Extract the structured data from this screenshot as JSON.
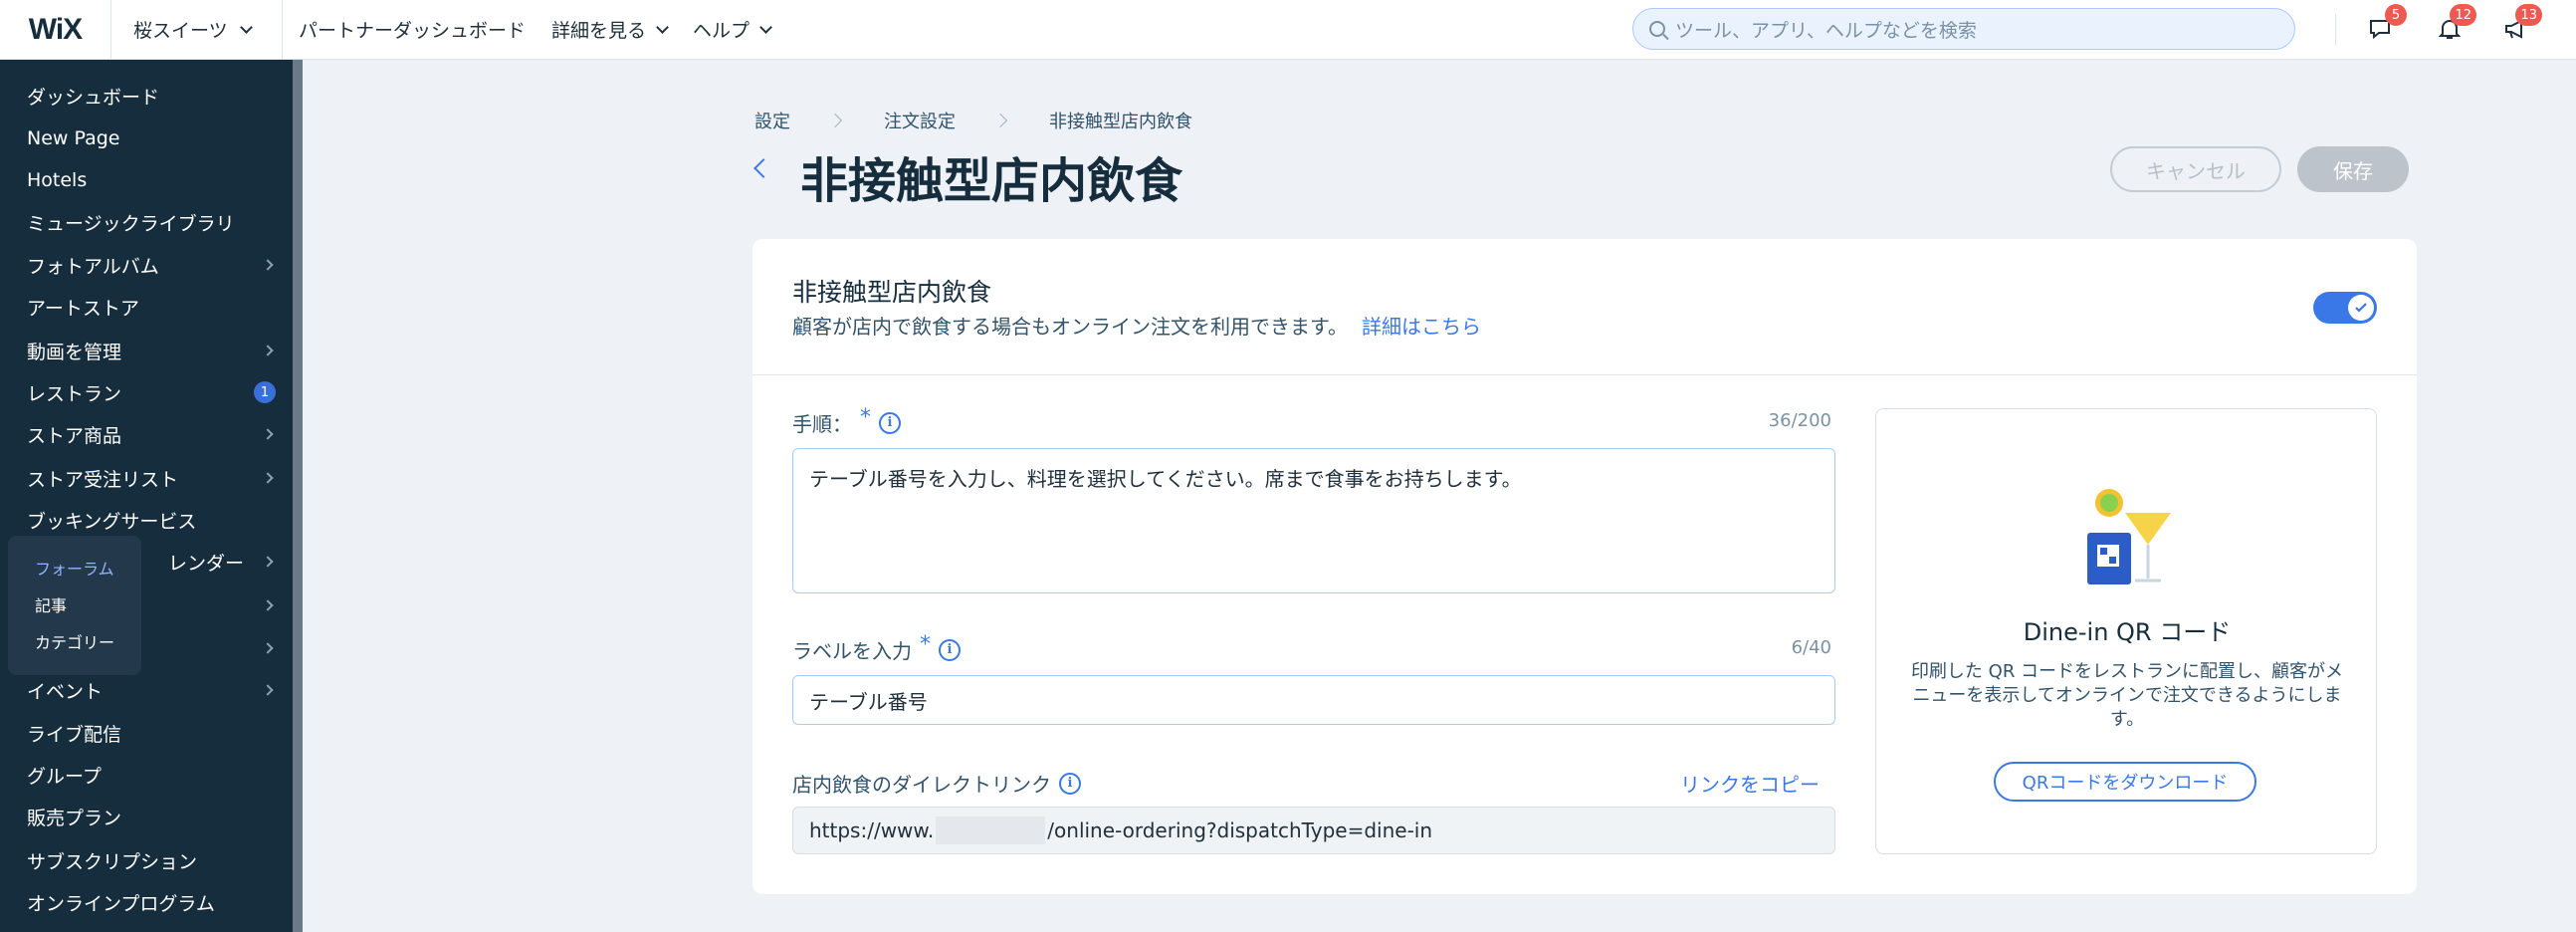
{
  "topbar": {
    "logo": "WiX",
    "site_name": "桜スイーツ",
    "nav": [
      "パートナーダッシュボード",
      "詳細を見る",
      "ヘルプ"
    ],
    "search_placeholder": "ツール、アプリ、ヘルプなどを検索",
    "badges": {
      "chat": "5",
      "notifications": "12",
      "announcements": "13"
    }
  },
  "sidebar": {
    "items": [
      {
        "label": "ダッシュボード",
        "chevron": false
      },
      {
        "label": "New Page",
        "chevron": false
      },
      {
        "label": "Hotels",
        "chevron": false
      },
      {
        "label": "ミュージックライブラリ",
        "chevron": false
      },
      {
        "label": "フォトアルバム",
        "chevron": true
      },
      {
        "label": "アートストア",
        "chevron": false
      },
      {
        "label": "動画を管理",
        "chevron": true
      },
      {
        "label": "レストラン",
        "badge": "1"
      },
      {
        "label": "ストア商品",
        "chevron": true
      },
      {
        "label": "ストア受注リスト",
        "chevron": true
      },
      {
        "label": "ブッキングサービス",
        "chevron": false
      },
      {
        "label": "レンダー",
        "chevron": true
      },
      {
        "label": "",
        "chevron": true
      },
      {
        "label": "",
        "chevron": true
      },
      {
        "label": "イベント",
        "chevron": true
      },
      {
        "label": "ライブ配信",
        "chevron": false
      },
      {
        "label": "グループ",
        "chevron": false
      },
      {
        "label": "販売プラン",
        "chevron": false
      },
      {
        "label": "サブスクリプション",
        "chevron": false
      },
      {
        "label": "オンラインプログラム",
        "chevron": false
      }
    ],
    "flyout": [
      "フォーラム",
      "記事",
      "カテゴリー"
    ]
  },
  "breadcrumb": [
    "設定",
    "注文設定",
    "非接触型店内飲食"
  ],
  "page_title": "非接触型店内飲食",
  "actions": {
    "cancel": "キャンセル",
    "save": "保存"
  },
  "section": {
    "title": "非接触型店内飲食",
    "subtitle": "顧客が店内で飲食する場合もオンライン注文を利用できます。",
    "learn_more": "詳細はこちら",
    "enabled": true
  },
  "fields": {
    "instructions": {
      "label": "手順：",
      "counter": "36/200",
      "value": "テーブル番号を入力し、料理を選択してください。席まで食事をお持ちします。"
    },
    "input_label": {
      "label": "ラベルを入力",
      "counter": "6/40",
      "value": "テーブル番号"
    },
    "direct_link": {
      "label": "店内飲食のダイレクトリンク",
      "copy": "リンクをコピー",
      "prefix": "https://www.",
      "suffix": "/online-ordering?dispatchType=dine-in"
    }
  },
  "qr": {
    "title": "Dine-in QR コード",
    "description": "印刷した QR コードをレストランに配置し、顧客がメニューを表示してオンラインで注文できるようにします。",
    "button": "QRコードをダウンロード"
  },
  "colors": {
    "accent": "#3b78e7",
    "sidebar": "#162d3d",
    "badge": "#ee5951"
  }
}
